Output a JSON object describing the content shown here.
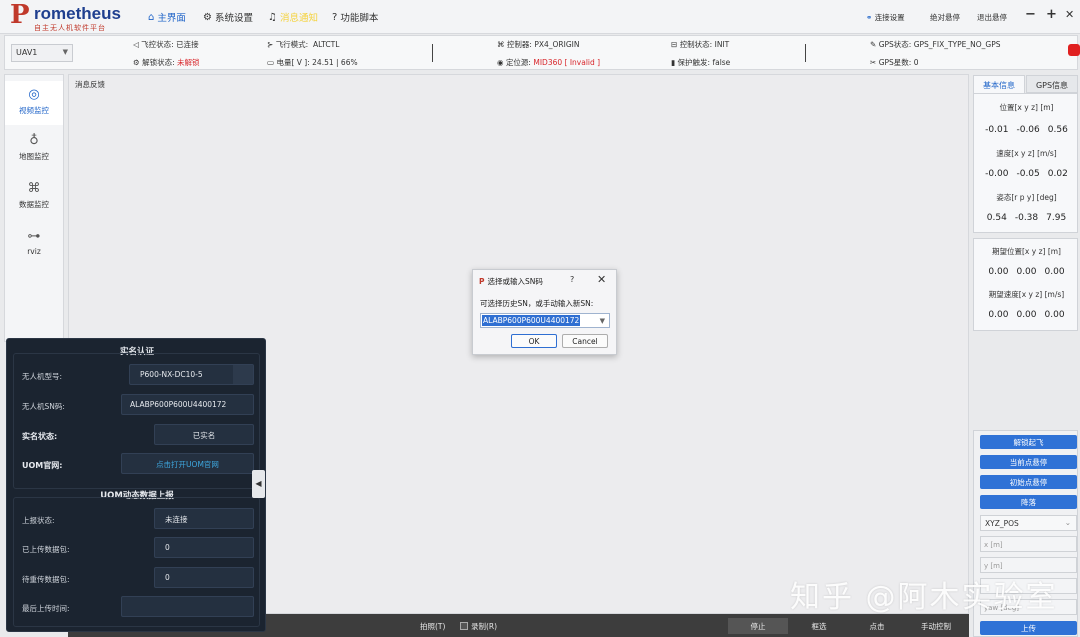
{
  "app": {
    "logo_main": "rometheus",
    "logo_letter": "P",
    "logo_sub": "自主无人机软件平台"
  },
  "menu": {
    "home": "主界面",
    "settings": "系统设置",
    "alerts": "消息通知",
    "scripts": "功能脚本",
    "connect": "连接设置",
    "hover": "绝对悬停",
    "exit_hover": "退出悬停",
    "minimize": "−",
    "maximize": "+",
    "close": "✕"
  },
  "status": {
    "uav": "UAV1",
    "flight_status_label": "飞控状态:",
    "flight_status": "已连接",
    "lock_status_label": "解锁状态:",
    "lock_status": "未解锁",
    "flight_mode_label": "飞行模式:",
    "flight_mode": "ALTCTL",
    "battery_label": "电量[ V ]:",
    "battery": "24.51 | 66%",
    "controller_label": "控制器:",
    "controller": "PX4_ORIGIN",
    "position_label": "定位源:",
    "position": "MID360 [ Invalid ]",
    "control_state_label": "控制状态:",
    "control_state": "INIT",
    "protect_label": "保护触发:",
    "protect": "false",
    "gps_status_label": "GPS状态:",
    "gps_status": "GPS_FIX_TYPE_NO_GPS",
    "gps_count_label": "GPS星数:",
    "gps_count": "0"
  },
  "sidebar": {
    "items": [
      {
        "label": "视频监控"
      },
      {
        "label": "地图监控"
      },
      {
        "label": "数据监控"
      },
      {
        "label": "rviz"
      }
    ]
  },
  "main": {
    "message_title": "消息反馈"
  },
  "bottombar": {
    "photo": "拍照(T)",
    "record": "录制(R)",
    "stop": "停止",
    "select": "框选",
    "click": "点击",
    "manual": "手动控制"
  },
  "right": {
    "tab_basic": "基本信息",
    "tab_gps": "GPS信息",
    "pos_label": "位置[x y z] [m]",
    "pos": [
      "-0.01",
      "-0.06",
      "0.56"
    ],
    "vel_label": "速度[x y z] [m/s]",
    "vel": [
      "-0.00",
      "-0.05",
      "0.02"
    ],
    "att_label": "姿态[r p y] [deg]",
    "att": [
      "0.54",
      "-0.38",
      "7.95"
    ],
    "exp_pos_label": "期望位置[x y z] [m]",
    "exp_pos": [
      "0.00",
      "0.00",
      "0.00"
    ],
    "exp_vel_label": "期望速度[x y z] [m/s]",
    "exp_vel": [
      "0.00",
      "0.00",
      "0.00"
    ],
    "btn_takeoff": "解锁起飞",
    "btn_hover": "当前点悬停",
    "btn_init_hover": "初始点悬停",
    "btn_land": "降落",
    "mode_select": "XYZ_POS",
    "x_placeholder": "x [m]",
    "y_placeholder": "y [m]",
    "yaw_placeholder": "yaw [deg]",
    "btn_upload": "上传"
  },
  "overlay": {
    "real_name_title": "实名认证",
    "model_label": "无人机型号:",
    "model": "P600-NX-DC10-5",
    "sn_label": "无人机SN码:",
    "sn": "ALABP600P600U4400172",
    "verify_label": "实名状态:",
    "verify": "已实名",
    "uom_label": "UOM官网:",
    "uom_link": "点击打开UOM官网",
    "uom_title": "UOM动态数据上报",
    "report_label": "上报状态:",
    "report": "未连接",
    "uploaded_label": "已上传数据包:",
    "uploaded": "0",
    "pending_label": "待重传数据包:",
    "pending": "0",
    "last_upload_label": "最后上传时间:",
    "last_upload": ""
  },
  "dialog": {
    "title": "选择或输入SN码",
    "help": "?",
    "close": "✕",
    "prompt": "可选择历史SN，或手动输入新SN:",
    "value": "ALABP600P600U4400172",
    "ok": "OK",
    "cancel": "Cancel"
  },
  "watermark": "知乎 @阿木实验室"
}
